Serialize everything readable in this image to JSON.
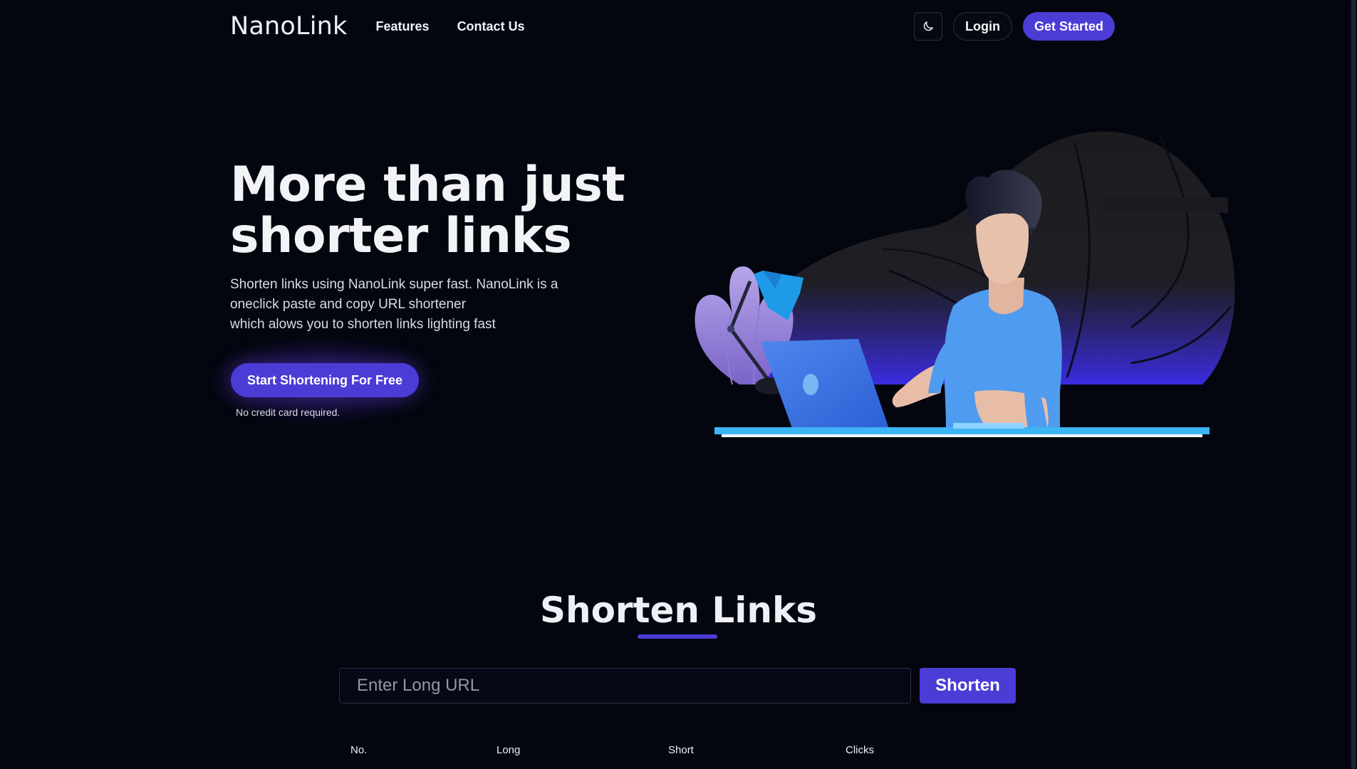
{
  "nav": {
    "logo": "NanoLink",
    "links": [
      "Features",
      "Contact Us"
    ],
    "login_label": "Login",
    "get_started_label": "Get Started",
    "theme_icon": "moon-icon"
  },
  "hero": {
    "title_line1": "More than just",
    "title_line2": "shorter links",
    "desc_lines": [
      "Shorten links using NanoLink super fast. NanoLink is a",
      "oneclick paste and copy URL shortener",
      "which alows you to shorten links lighting fast"
    ],
    "cta_label": "Start Shortening For Free",
    "note": "No credit card required."
  },
  "shorten": {
    "title": "Shorten Links",
    "input_placeholder": "Enter Long URL",
    "button_label": "Shorten",
    "table_headers": [
      "No.",
      "Long",
      "Short",
      "Clicks"
    ]
  },
  "colors": {
    "background": "#03060f",
    "accent": "#4b3cd6",
    "text": "#eef0f5"
  }
}
